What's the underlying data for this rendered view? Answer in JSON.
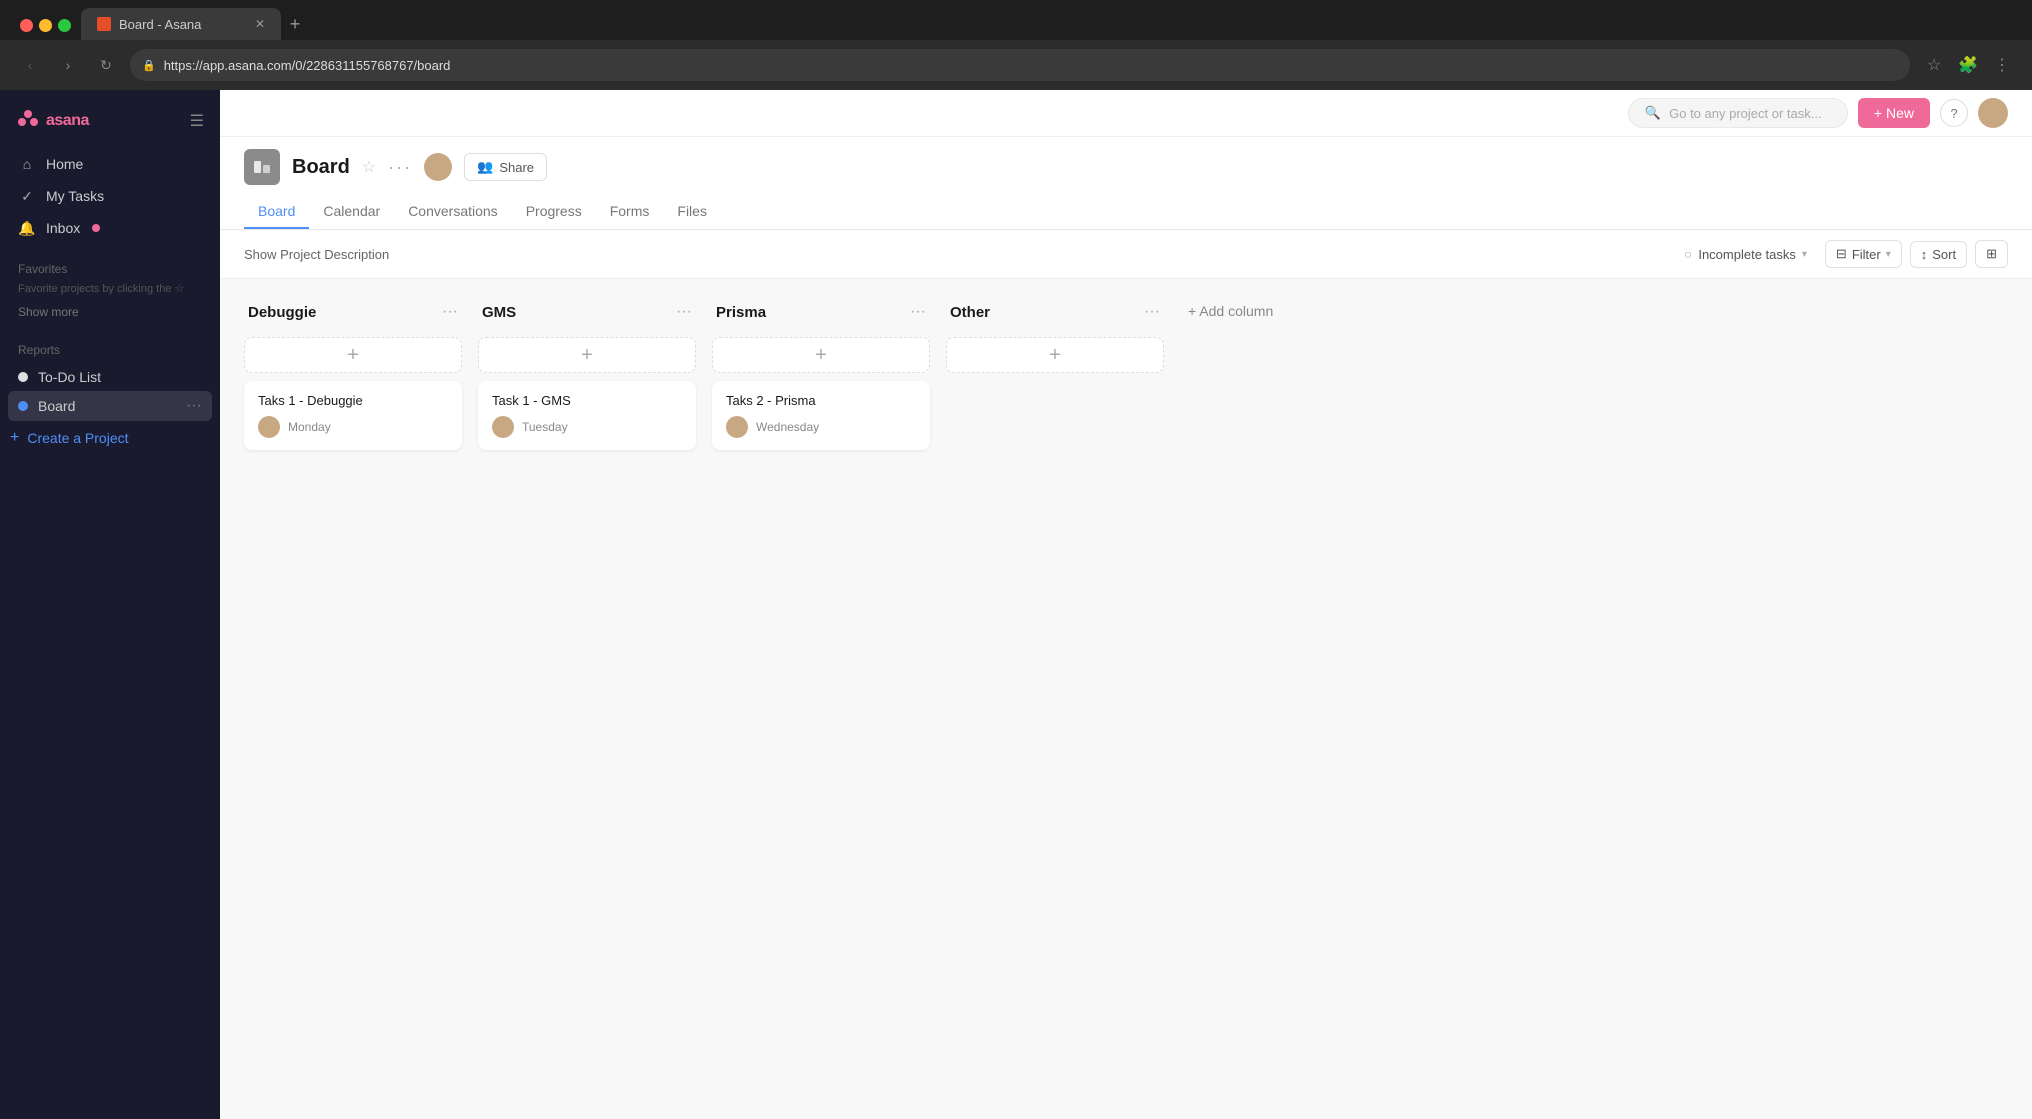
{
  "browser": {
    "url": "https://app.asana.com/0/228631155768767/board",
    "tab_title": "Board - Asana",
    "tab_new_label": "+"
  },
  "sidebar": {
    "logo_text": "asana",
    "toggle_icon": "☰",
    "nav_items": [
      {
        "id": "home",
        "label": "Home",
        "icon": "⌂"
      },
      {
        "id": "my-tasks",
        "label": "My Tasks",
        "icon": "✓"
      },
      {
        "id": "inbox",
        "label": "Inbox",
        "icon": "🔔",
        "badge": true
      }
    ],
    "favorites_label": "Favorites",
    "favorites_hint": "Favorite projects by clicking the ☆",
    "show_more": "Show more",
    "reports_label": "Reports",
    "projects": [
      {
        "id": "to-do-list",
        "label": "To-Do List",
        "dot_color": "#e0e0e0",
        "active": false
      },
      {
        "id": "board",
        "label": "Board",
        "dot_color": "#4f8ef7",
        "active": true
      }
    ],
    "create_project_label": "Create a Project"
  },
  "header": {
    "project_title": "Board",
    "tabs": [
      {
        "id": "board",
        "label": "Board",
        "active": true
      },
      {
        "id": "calendar",
        "label": "Calendar",
        "active": false
      },
      {
        "id": "conversations",
        "label": "Conversations",
        "active": false
      },
      {
        "id": "progress",
        "label": "Progress",
        "active": false
      },
      {
        "id": "forms",
        "label": "Forms",
        "active": false
      },
      {
        "id": "files",
        "label": "Files",
        "active": false
      }
    ],
    "share_label": "Share"
  },
  "toolbar": {
    "show_desc_label": "Show Project Description",
    "incomplete_label": "Incomplete tasks",
    "filter_label": "Filter",
    "sort_label": "Sort",
    "new_label": "+ New",
    "search_placeholder": "Go to any project or task..."
  },
  "board": {
    "columns": [
      {
        "id": "debuggie",
        "title": "Debuggie",
        "tasks": [
          {
            "id": "task-1-debuggie",
            "title": "Taks 1 - Debuggie",
            "date": "Monday"
          }
        ]
      },
      {
        "id": "gms",
        "title": "GMS",
        "tasks": [
          {
            "id": "task-1-gms",
            "title": "Task 1 - GMS",
            "date": "Tuesday"
          }
        ]
      },
      {
        "id": "prisma",
        "title": "Prisma",
        "tasks": [
          {
            "id": "taks-2-prisma",
            "title": "Taks 2 - Prisma",
            "date": "Wednesday"
          }
        ]
      },
      {
        "id": "other",
        "title": "Other",
        "tasks": []
      }
    ],
    "add_column_label": "+ Add column"
  },
  "icons": {
    "star": "☆",
    "more": "···",
    "plus": "+",
    "search": "🔍",
    "question": "?",
    "back": "‹",
    "forward": "›",
    "refresh": "↻",
    "lock": "🔒",
    "filter": "⊟",
    "sort": "↕",
    "incomplete_circle": "○"
  }
}
